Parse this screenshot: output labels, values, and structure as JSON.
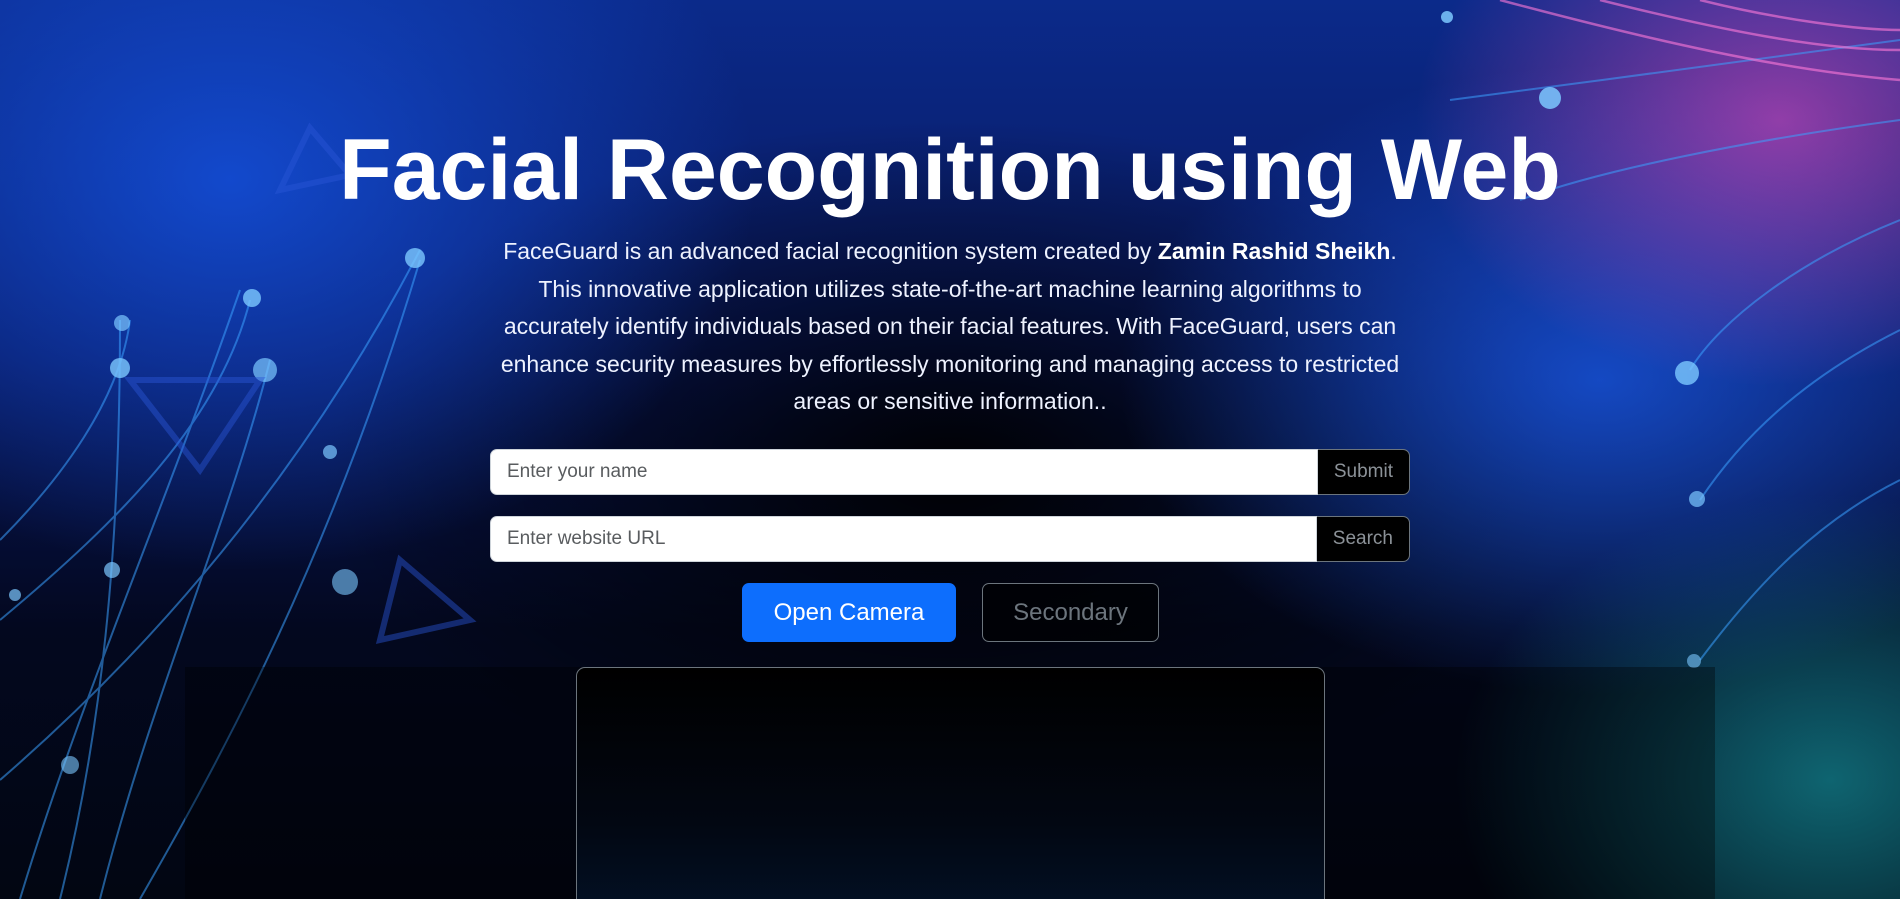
{
  "hero": {
    "title": "Facial Recognition using Web",
    "description_before": "FaceGuard is an advanced facial recognition system created by ",
    "author": "Zamin Rashid Sheikh",
    "description_after": ". This innovative application utilizes state-of-the-art machine learning algorithms to accurately identify individuals based on their facial features. With FaceGuard, users can enhance security measures by effortlessly monitoring and managing access to restricted areas or sensitive information.."
  },
  "name_form": {
    "placeholder": "Enter your name",
    "value": "",
    "submit_label": "Submit"
  },
  "url_form": {
    "placeholder": "Enter website URL",
    "value": "",
    "search_label": "Search"
  },
  "actions": {
    "open_camera_label": "Open Camera",
    "secondary_label": "Secondary"
  },
  "colors": {
    "primary": "#0d6efd",
    "secondary_border": "#6c757d",
    "title": "#ffffff"
  }
}
